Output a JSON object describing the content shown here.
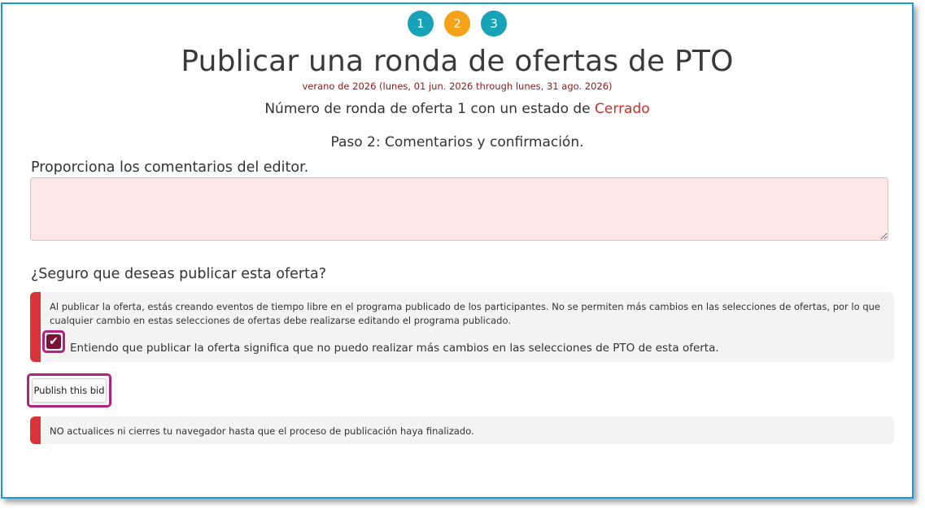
{
  "steps": [
    "1",
    "2",
    "3"
  ],
  "title": "Publicar una ronda de ofertas de PTO",
  "dates": "verano de 2026 (lunes, 01 jun. 2026 through lunes, 31 ago. 2026)",
  "round": {
    "prefix": "Número de ronda de oferta 1 con un estado de",
    "status": "Cerrado"
  },
  "step_line": "Paso 2: Comentarios y confirmación.",
  "comments": {
    "label": "Proporciona los comentarios del editor.",
    "value": ""
  },
  "confirm_question": "¿Seguro que deseas publicar esta oferta?",
  "publish_warning": "Al publicar la oferta, estás creando eventos de tiempo libre en el programa publicado de los participantes. No se permiten más cambios en las selecciones de ofertas, por lo que cualquier cambio en estas selecciones de ofertas debe realizarse editando el programa publicado.",
  "acknowledge": {
    "checked": true,
    "label": "Entiendo que publicar la oferta significa que no puedo realizar más cambios en las selecciones de PTO de esta oferta."
  },
  "publish_button": "Publish this bid",
  "browser_warning": "NO actualices ni cierres tu navegador hasta que el proceso de publicación haya finalizado.",
  "colors": {
    "step_done": "#17a2b8",
    "step_active": "#f6a219",
    "status_closed": "#c9302c",
    "alert_accent": "#d9343a",
    "highlight": "#b0237f"
  }
}
